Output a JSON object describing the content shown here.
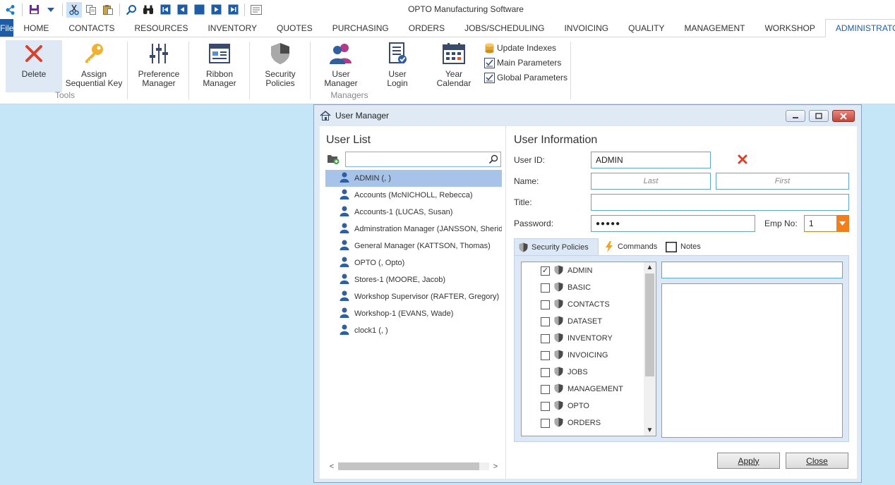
{
  "app": {
    "title": "OPTO Manufacturing Software"
  },
  "quick_access": [
    "app-logo",
    "save",
    "dropdown",
    "cut",
    "copy",
    "paste",
    "search",
    "find",
    "first",
    "previous",
    "stop",
    "next",
    "last",
    "notes"
  ],
  "tabs": {
    "file": "File",
    "items": [
      "HOME",
      "CONTACTS",
      "RESOURCES",
      "INVENTORY",
      "QUOTES",
      "PURCHASING",
      "ORDERS",
      "JOBS/SCHEDULING",
      "INVOICING",
      "QUALITY",
      "MANAGEMENT",
      "WORKSHOP",
      "ADMINISTRATOR"
    ],
    "active": "ADMINISTRATOR"
  },
  "ribbon": {
    "tools": {
      "label": "Tools",
      "delete": "Delete",
      "assign_line1": "Assign",
      "assign_line2": "Sequential Key"
    },
    "managers": {
      "label": "Managers",
      "pref_line1": "Preference",
      "pref_line2": "Manager",
      "ribbon_line1": "Ribbon",
      "ribbon_line2": "Manager",
      "sec_line1": "Security",
      "sec_line2": "Policies",
      "user_line1": "User",
      "user_line2": "Manager",
      "login_line1": "User",
      "login_line2": "Login",
      "year_line1": "Year",
      "year_line2": "Calendar",
      "update_indexes": "Update Indexes",
      "main_parameters": "Main Parameters",
      "global_parameters": "Global Parameters"
    }
  },
  "dialog": {
    "title": "User Manager",
    "user_list": {
      "heading": "User List",
      "search_value": "",
      "users": [
        "ADMIN (, )",
        "Accounts (McNICHOLL, Rebecca)",
        "Accounts-1 (LUCAS, Susan)",
        "Adminstration Manager (JANSSON, Sheridan)",
        "General Manager (KATTSON, Thomas)",
        "OPTO (, Opto)",
        "Stores-1 (MOORE, Jacob)",
        "Workshop Supervisor (RAFTER, Gregory)",
        "Workshop-1 (EVANS, Wade)",
        "clock1 (, )"
      ],
      "selected_index": 0
    },
    "user_info": {
      "heading": "User Information",
      "user_id_label": "User ID:",
      "user_id": "ADMIN",
      "name_label": "Name:",
      "last_placeholder": "Last",
      "first_placeholder": "First",
      "title_label": "Title:",
      "title_value": "",
      "password_label": "Password:",
      "password_mask": "●●●●●",
      "emp_no_label": "Emp No:",
      "emp_no": "1"
    },
    "sub_tabs": [
      "Security Policies",
      "Commands",
      "Notes"
    ],
    "active_sub_tab": "Security Policies",
    "policies": [
      {
        "name": "ADMIN",
        "checked": true
      },
      {
        "name": "BASIC",
        "checked": false
      },
      {
        "name": "CONTACTS",
        "checked": false
      },
      {
        "name": "DATASET",
        "checked": false
      },
      {
        "name": "INVENTORY",
        "checked": false
      },
      {
        "name": "INVOICING",
        "checked": false
      },
      {
        "name": "JOBS",
        "checked": false
      },
      {
        "name": "MANAGEMENT",
        "checked": false
      },
      {
        "name": "OPTO",
        "checked": false
      },
      {
        "name": "ORDERS",
        "checked": false
      }
    ],
    "apply_button": "Apply",
    "close_button": "Close"
  },
  "colors": {
    "accent": "#1e5ca8",
    "background": "#c4e6f7",
    "selection": "#a7c3ea",
    "delete_red": "#d9412e",
    "emp_dropdown": "#f27f1b"
  }
}
